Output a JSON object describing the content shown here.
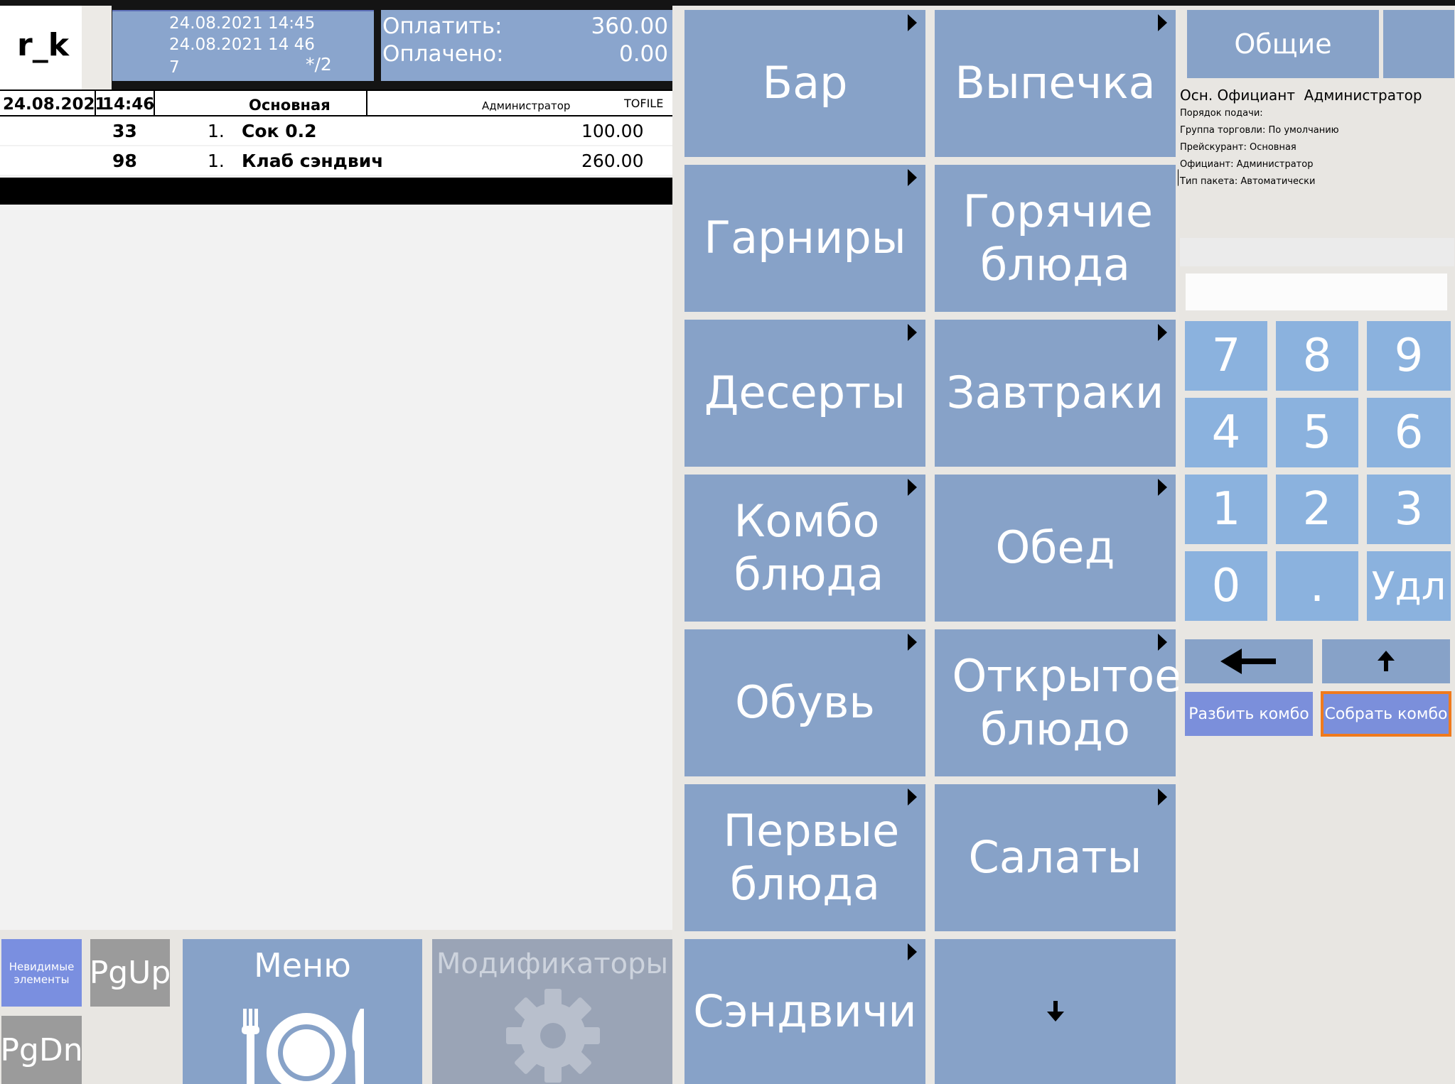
{
  "header": {
    "logo": "r_k",
    "opened": "24.08.2021 14:45",
    "printed": "24.08.2021 14 46",
    "table_no": "7",
    "guests": "*/2",
    "to_pay_label": "Оплатить:",
    "to_pay_value": "360.00",
    "paid_label": "Оплачено:",
    "paid_value": "0.00"
  },
  "order_header": {
    "date": "24.08.2021",
    "time": "14:46",
    "course": "Основная",
    "waiter": "Администратор",
    "station": "TOFILE"
  },
  "order_items": [
    {
      "code": "33",
      "qty": "1.",
      "name": "Сок 0.2",
      "price": "100.00"
    },
    {
      "code": "98",
      "qty": "1.",
      "name": "Клаб сэндвич",
      "price": "260.00"
    }
  ],
  "bottom": {
    "invisible_elements": "Невидимые элементы",
    "pgup": "PgUp",
    "pgdn": "PgDn",
    "menu": "Меню",
    "modifiers": "Модификаторы"
  },
  "categories": [
    {
      "label": "Бар"
    },
    {
      "label": "Выпечка"
    },
    {
      "label": "Гарниры"
    },
    {
      "label": "Горячие блюда"
    },
    {
      "label": "Десерты"
    },
    {
      "label": "Завтраки"
    },
    {
      "label": "Комбо блюда"
    },
    {
      "label": "Обед"
    },
    {
      "label": "Обувь"
    },
    {
      "label": "Открытое блюдо"
    },
    {
      "label": "Первые блюда"
    },
    {
      "label": "Салаты"
    },
    {
      "label": "Сэндвичи"
    }
  ],
  "right": {
    "general_tab": "Общие",
    "info_main": "Осн. Официант  Администратор",
    "info_lines": [
      "Порядок подачи:",
      "Группа торговли: По умолчанию",
      "Прейскурант: Основная",
      "Официант: Администратор",
      "Тип пакета: Автоматически"
    ],
    "input_value": "",
    "keys": [
      "7",
      "8",
      "9",
      "4",
      "5",
      "6",
      "1",
      "2",
      "3",
      "0",
      ".",
      "Удл"
    ],
    "split_combo": "Разбить комбо",
    "assemble_combo": "Собрать комбо"
  },
  "colors": {
    "tile_blue": "#87a2c8",
    "numpad_blue": "#8bb2de",
    "combo_button": "#7b8fdb",
    "selected_border": "#f07a1c"
  }
}
